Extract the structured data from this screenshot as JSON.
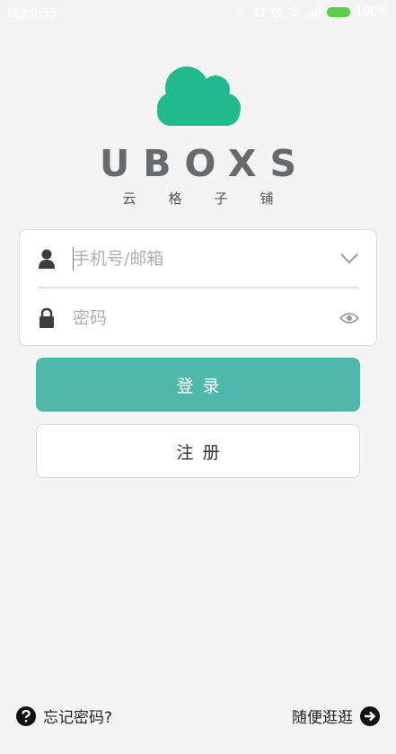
{
  "status_bar": {
    "time": "晚上9:35",
    "dots": "...",
    "battery": "100%"
  },
  "brand": {
    "title": "UBOXS",
    "subtitle": "云格子铺",
    "logo_icon": "cloud-icon",
    "logo_color": "#22b98c"
  },
  "form": {
    "account": {
      "placeholder": "手机号/邮箱",
      "value": "",
      "leading_icon": "user-icon",
      "trailing_icon": "chevron-down-icon"
    },
    "password": {
      "placeholder": "密码",
      "value": "",
      "leading_icon": "lock-icon",
      "trailing_icon": "eye-icon"
    }
  },
  "buttons": {
    "login_label": "登录",
    "register_label": "注册",
    "accent_color": "#4fb8ab"
  },
  "footer": {
    "forgot_label": "忘记密码?",
    "forgot_icon": "question-circle-icon",
    "browse_label": "随便逛逛",
    "browse_icon": "arrow-right-circle-icon"
  }
}
